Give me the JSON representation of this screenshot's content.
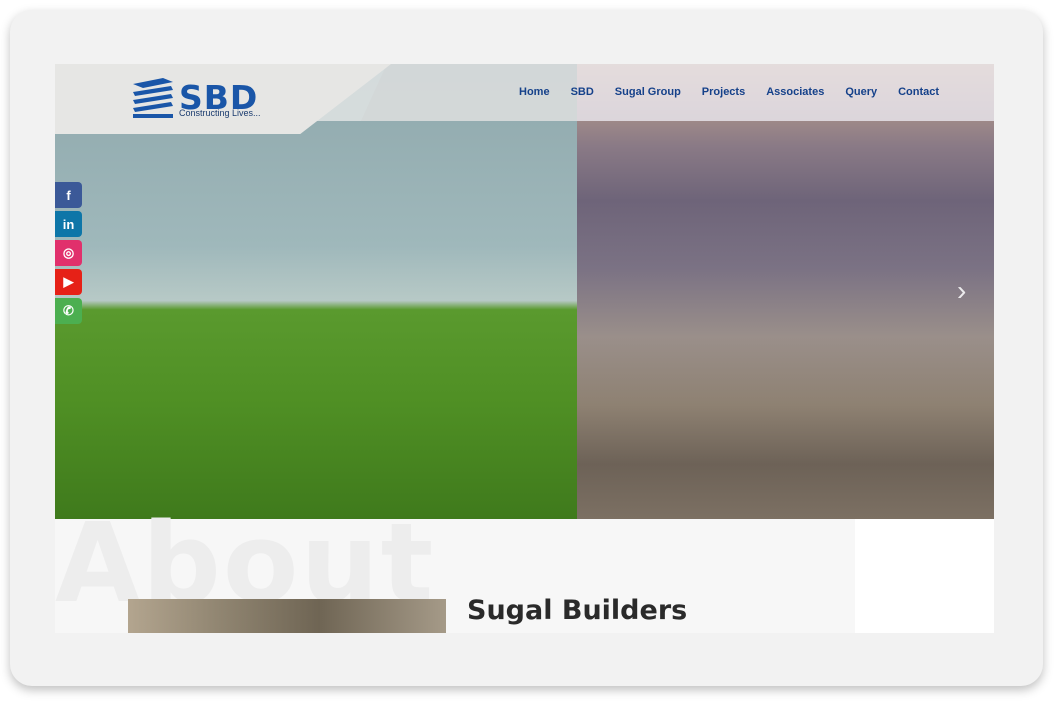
{
  "logo": {
    "brand": "SBD",
    "tagline": "Constructing Lives..."
  },
  "nav": {
    "items": [
      {
        "label": "Home"
      },
      {
        "label": "SBD"
      },
      {
        "label": "Sugal Group"
      },
      {
        "label": "Projects"
      },
      {
        "label": "Associates"
      },
      {
        "label": "Query"
      },
      {
        "label": "Contact"
      }
    ]
  },
  "social": [
    {
      "icon": "facebook-icon",
      "glyph": "f",
      "color": "#3b5998"
    },
    {
      "icon": "linkedin-icon",
      "glyph": "in",
      "color": "#0e76a8"
    },
    {
      "icon": "instagram-icon",
      "glyph": "◎",
      "color": "#e1306c"
    },
    {
      "icon": "youtube-icon",
      "glyph": "▶",
      "color": "#e62117"
    },
    {
      "icon": "whatsapp-icon",
      "glyph": "✆",
      "color": "#4caf50"
    }
  ],
  "carousel": {
    "next_glyph": "›"
  },
  "about": {
    "background_word": "About",
    "heading": "Sugal Builders"
  }
}
